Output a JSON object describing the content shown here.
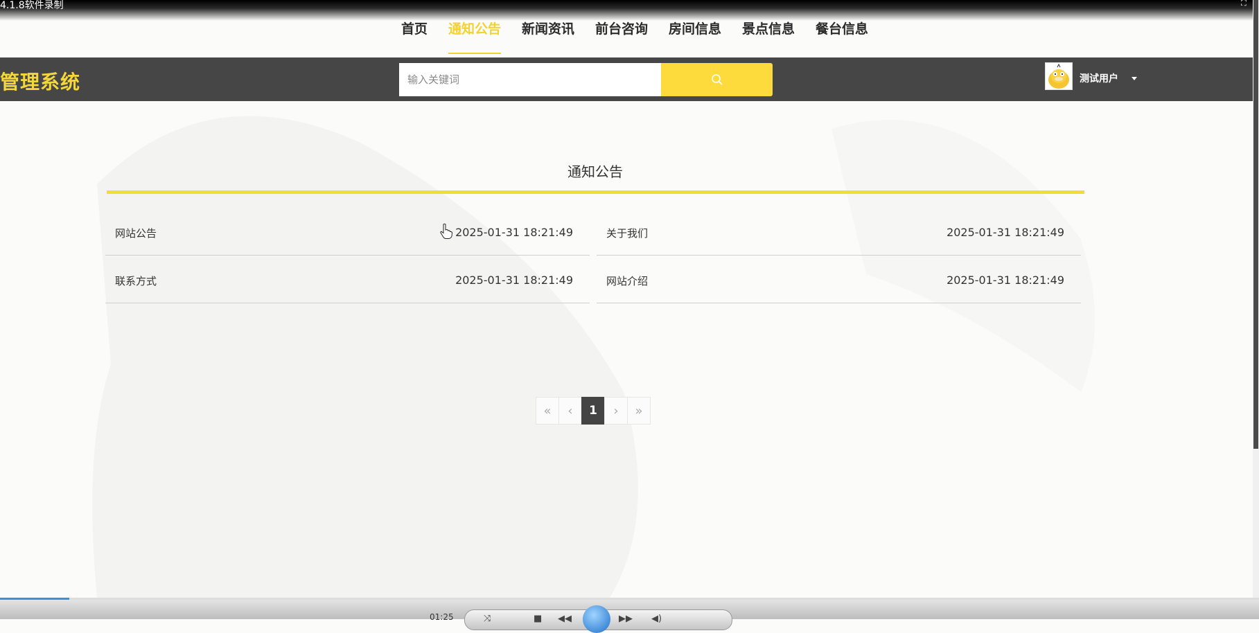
{
  "recorder": {
    "title": "4.1.8软件录制",
    "time": "01:25",
    "progress_fraction": 0.055
  },
  "nav": {
    "items": [
      {
        "label": "首页",
        "active": false
      },
      {
        "label": "通知公告",
        "active": true
      },
      {
        "label": "新闻资讯",
        "active": false
      },
      {
        "label": "前台咨询",
        "active": false
      },
      {
        "label": "房间信息",
        "active": false
      },
      {
        "label": "景点信息",
        "active": false
      },
      {
        "label": "餐台信息",
        "active": false
      }
    ]
  },
  "header": {
    "brand": "管理系统",
    "search_placeholder": "输入关键词",
    "search_value": "",
    "user_name": "测试用户"
  },
  "section": {
    "title": "通知公告"
  },
  "notices": [
    {
      "title": "网站公告",
      "date": "2025-01-31 18:21:49"
    },
    {
      "title": "关于我们",
      "date": "2025-01-31 18:21:49"
    },
    {
      "title": "联系方式",
      "date": "2025-01-31 18:21:49"
    },
    {
      "title": "网站介绍",
      "date": "2025-01-31 18:21:49"
    }
  ],
  "pagination": {
    "first": "«",
    "prev": "‹",
    "current": "1",
    "next": "›",
    "last": "»"
  },
  "colors": {
    "accent": "#f2d232",
    "header_bg": "#464646",
    "search_button": "#fedb3d",
    "brand": "#f4d73a"
  },
  "icons": {
    "search": "search-icon",
    "user_dropdown": "caret-down-icon",
    "avatar": "duck-avatar"
  }
}
